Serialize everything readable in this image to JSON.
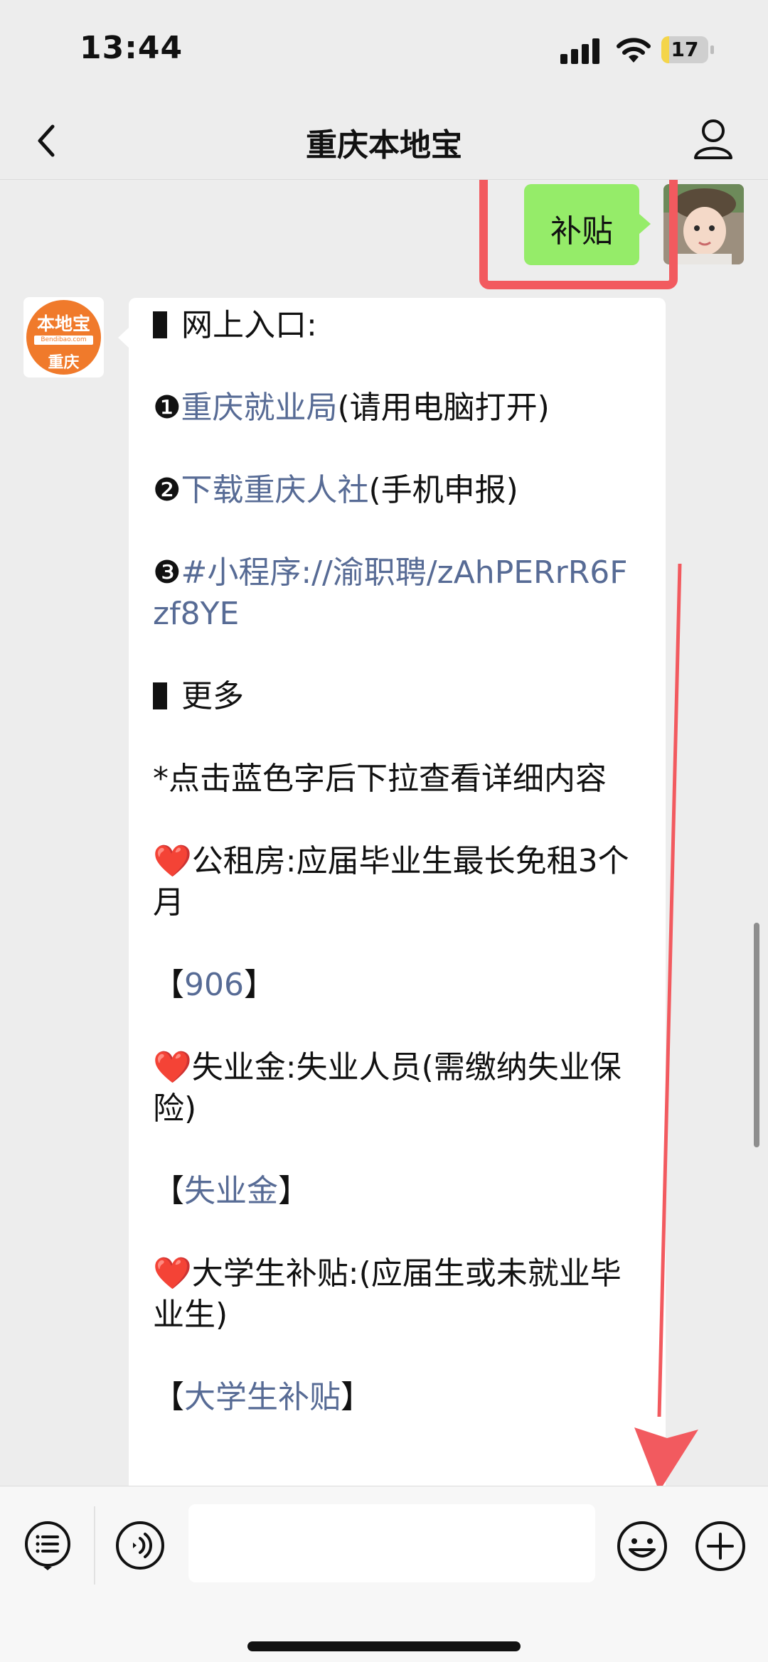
{
  "status_bar": {
    "time": "13:44",
    "battery_level": "17",
    "battery_fraction": 0.17,
    "icons": [
      "signal-icon",
      "wifi-icon",
      "battery-icon"
    ]
  },
  "nav": {
    "title": "重庆本地宝",
    "back_icon": "chevron-left-icon",
    "profile_icon": "person-icon"
  },
  "outgoing": {
    "text": "补贴"
  },
  "bot_avatar": {
    "logo_top": "本地宝",
    "logo_mid": "Bendibao.com",
    "logo_bottom": "重庆"
  },
  "message": {
    "section1_title": "网上入口:",
    "num1": "❶",
    "link1": "重庆就业局",
    "note1": "(请用电脑打开)",
    "num2": "❷",
    "link2": "下载重庆人社",
    "note2": "(手机申报)",
    "num3": "❸",
    "link3": "#小程序://渝职聘/zAhPERrR6Fzf8YE",
    "section2_title": "更多",
    "hint": "*点击蓝色字后下拉查看详细内容",
    "item1_heart": "❤️",
    "item1_text": "公租房:应届毕业生最长免租3个月",
    "item1_open": "【",
    "item1_link": "906",
    "item1_close": "】",
    "item2_heart": "❤️",
    "item2_text": "失业金:失业人员(需缴纳失业保险)",
    "item2_open": "【",
    "item2_link": "失业金",
    "item2_close": "】",
    "item3_heart": "❤️",
    "item3_text": "大学生补贴:(应届生或未就业毕业生)",
    "item3_open": "【",
    "item3_link": "大学生补贴",
    "item3_close": "】"
  },
  "input_bar": {
    "placeholder": "",
    "icons": [
      "list-menu-icon",
      "voice-icon",
      "emoji-icon",
      "plus-icon"
    ]
  },
  "colors": {
    "bubble_out": "#95ec69",
    "link": "#576b95",
    "annotation": "#f25a5f",
    "background": "#ededed"
  }
}
